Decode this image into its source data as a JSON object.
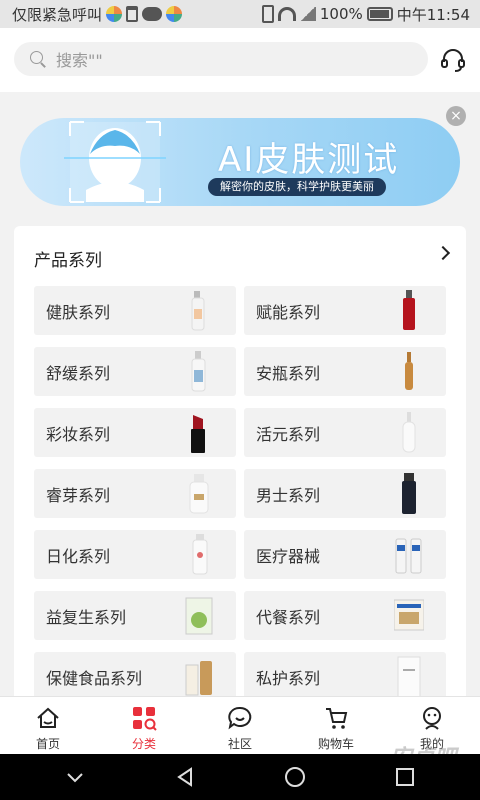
{
  "status_bar": {
    "carrier": "仅限紧急呼叫",
    "battery": "100%",
    "time": "中午11:54",
    "icons": [
      "multicolor-app-icon",
      "usb-icon",
      "wechat-icon",
      "multicolor-app-icon",
      "vibrate-icon",
      "wifi-icon",
      "signal-icon",
      "battery-icon"
    ]
  },
  "header": {
    "search_placeholder": "搜索\"\"",
    "service_icon": "customer-service-headset-icon"
  },
  "banner": {
    "title": "AI皮肤测试",
    "subtitle": "解密你的皮肤，科学护肤更美丽",
    "close_icon": "close-icon"
  },
  "products": {
    "title": "产品系列",
    "categories": [
      {
        "label": "健肤系列",
        "thumb": "spray-bottle-white"
      },
      {
        "label": "赋能系列",
        "thumb": "bottle-red"
      },
      {
        "label": "舒缓系列",
        "thumb": "spray-bottle-blue"
      },
      {
        "label": "安瓶系列",
        "thumb": "ampoule"
      },
      {
        "label": "彩妆系列",
        "thumb": "lipstick"
      },
      {
        "label": "活元系列",
        "thumb": "dropper-bottle"
      },
      {
        "label": "睿芽系列",
        "thumb": "cream-jar"
      },
      {
        "label": "男士系列",
        "thumb": "bottle-dark"
      },
      {
        "label": "日化系列",
        "thumb": "pump-bottle"
      },
      {
        "label": "医疗器械",
        "thumb": "tubes"
      },
      {
        "label": "益复生系列",
        "thumb": "box-green"
      },
      {
        "label": "代餐系列",
        "thumb": "box-food"
      },
      {
        "label": "保健食品系列",
        "thumb": "supplement-bottles"
      },
      {
        "label": "私护系列",
        "thumb": "box-white"
      }
    ]
  },
  "tabbar": {
    "tabs": [
      {
        "label": "首页",
        "icon": "home-icon",
        "active": false
      },
      {
        "label": "分类",
        "icon": "category-icon",
        "active": true
      },
      {
        "label": "社区",
        "icon": "community-icon",
        "active": false
      },
      {
        "label": "购物车",
        "icon": "cart-icon",
        "active": false
      },
      {
        "label": "我的",
        "icon": "profile-icon",
        "active": false
      }
    ]
  },
  "watermark": "安卓吧",
  "colors": {
    "accent": "#e8303b",
    "banner_start": "#cde8fb",
    "banner_end": "#8ecdf3",
    "banner_pill": "#1e3a5c"
  },
  "system_nav": [
    "back-icon",
    "home-circle-icon",
    "recents-icon",
    "down-chevron-icon"
  ]
}
